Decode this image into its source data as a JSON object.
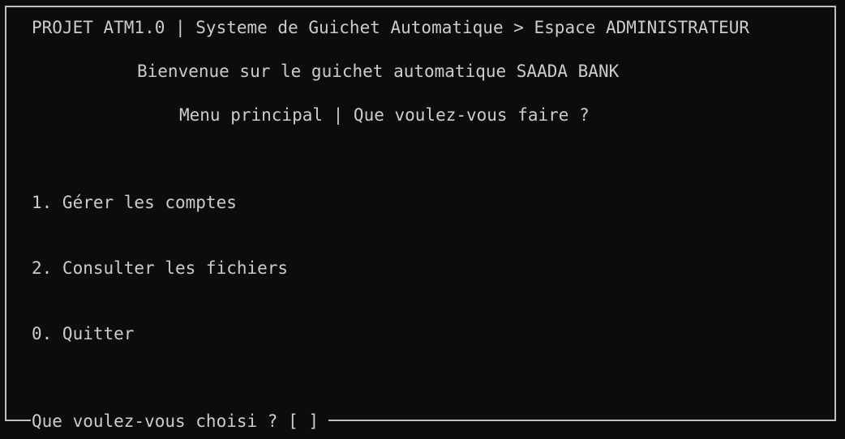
{
  "header": {
    "title": "PROJET ATM1.0 | Systeme de Guichet Automatique > Espace ADMINISTRATEUR",
    "welcome": "Bienvenue sur le guichet automatique SAADA BANK",
    "menu_heading": "Menu principal | Que voulez-vous faire ?"
  },
  "menu": {
    "items": [
      {
        "label": "1. Gérer les comptes"
      },
      {
        "label": "2. Consulter les fichiers"
      },
      {
        "label": "0. Quitter"
      }
    ]
  },
  "prompt": {
    "text": "Que voulez-vous choisi ? [ ]"
  },
  "colors": {
    "background": "#0c0c0c",
    "foreground": "#cccccc",
    "border": "#c0c0c0"
  }
}
